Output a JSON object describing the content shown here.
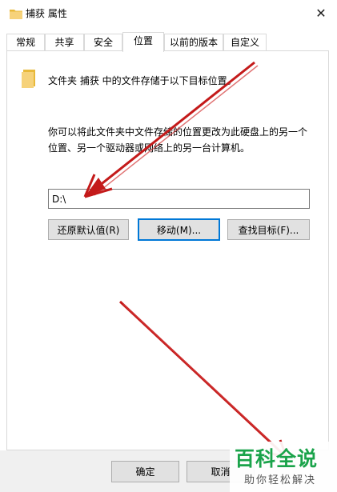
{
  "window": {
    "title": "捕获 属性",
    "close_glyph": "✕"
  },
  "tabs": [
    {
      "label": "常规"
    },
    {
      "label": "共享"
    },
    {
      "label": "安全"
    },
    {
      "label": "位置",
      "active": true
    },
    {
      "label": "以前的版本"
    },
    {
      "label": "自定义"
    }
  ],
  "location": {
    "title": "文件夹 捕获 中的文件存储于以下目标位置。",
    "description_line1": "你可以将此文件夹中文件存储的位置更改为此硬盘上的另一个",
    "description_line2": "位置、另一个驱动器或网络上的另一台计算机。",
    "path_value": "D:\\"
  },
  "buttons": {
    "restore_default": "还原默认值(R)",
    "move": "移动(M)...",
    "find_target": "查找目标(F)...",
    "ok": "确定",
    "cancel": "取消"
  },
  "watermark": {
    "main": "百科全说",
    "sub": "助你轻松解决"
  },
  "colors": {
    "accent_focus": "#0078d7",
    "annotation_arrow": "#c41a1a",
    "watermark_green": "#1aa34a"
  },
  "icons": {
    "title_icon": "folder-icon",
    "folder_icon": "folder-icon",
    "close": "close-icon"
  }
}
